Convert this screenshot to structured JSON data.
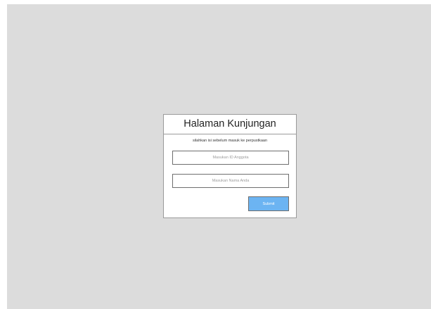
{
  "form": {
    "title": "Halaman Kunjungan",
    "subtitle": "silahkan isi sebelum masuk ke perpustkaan",
    "member_id_field": {
      "value": "",
      "placeholder": "Masukan ID Anggota"
    },
    "name_field": {
      "value": "",
      "placeholder": "Masukan Nama Anda"
    },
    "submit_label": "Submit"
  },
  "colors": {
    "background": "#dcdcdc",
    "card": "#ffffff",
    "submit_button": "#6cb4f2"
  }
}
